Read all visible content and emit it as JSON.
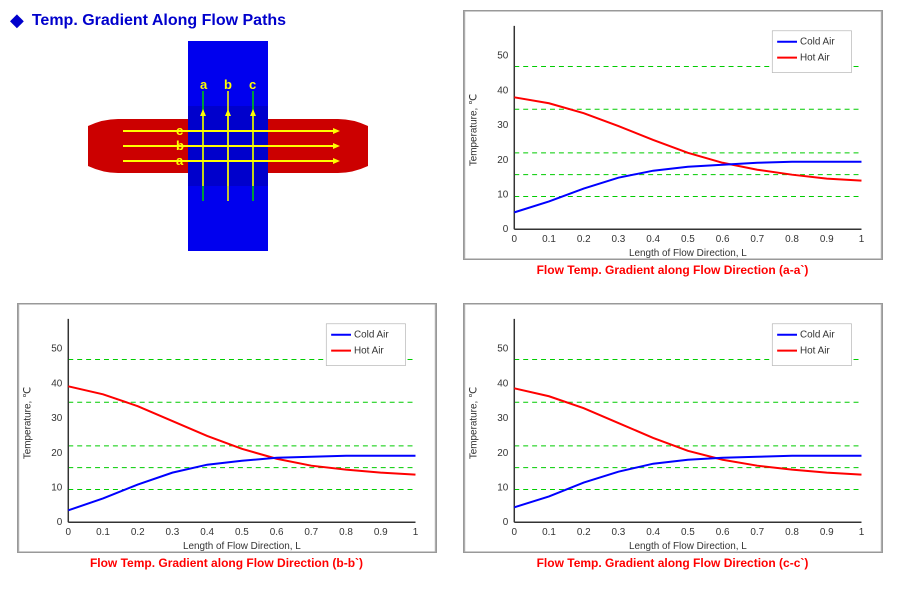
{
  "title": "Temp. Gradient Along Flow Paths",
  "charts": {
    "aa": {
      "title": "Flow Temp. Gradient along Flow Direction (a-a`)",
      "legend": {
        "cold": "Cold Air",
        "hot": "Hot Air"
      }
    },
    "bb": {
      "title": "Flow Temp. Gradient along Flow Direction (b-b`)",
      "legend": {
        "cold": "Cold Air",
        "hot": "Hot Air"
      }
    },
    "cc": {
      "title": "Flow Temp. Gradient along Flow Direction (c-c`)",
      "legend": {
        "cold": "Cold Air",
        "hot": "Hot Air"
      }
    }
  },
  "axis": {
    "xLabel": "Length of Flow Direction, L",
    "yLabel": "Temperature, ℃"
  },
  "legend": {
    "coldAir": "Cold Air",
    "hotAir": "Hot Air"
  }
}
